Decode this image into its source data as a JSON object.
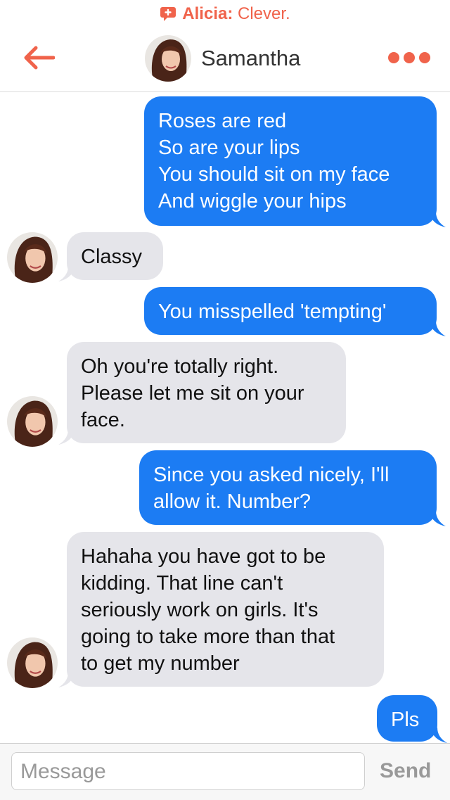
{
  "notification": {
    "sender": "Alicia",
    "separator": ":",
    "message": "Clever."
  },
  "header": {
    "contact_name": "Samantha",
    "back_icon": "arrow-left-icon",
    "more_icon": "ellipsis-icon"
  },
  "colors": {
    "accent": "#f0634b",
    "outgoing": "#1c7cf3",
    "incoming": "#e5e5ea"
  },
  "messages": [
    {
      "direction": "out",
      "text": "Roses are red\nSo are your lips\nYou should sit on my face\nAnd wiggle your hips"
    },
    {
      "direction": "in",
      "text": "Classy"
    },
    {
      "direction": "out",
      "text": "You misspelled 'tempting'"
    },
    {
      "direction": "in",
      "text": "Oh you're totally right.\nPlease let me sit on your\nface."
    },
    {
      "direction": "out",
      "text": "Since you asked nicely, I'll\nallow it. Number?"
    },
    {
      "direction": "in",
      "text": "Hahaha you have got to be\nkidding. That line can't\nseriously work on girls. It's\ngoing to take more than that\nto get my number"
    },
    {
      "direction": "out",
      "text": "Pls"
    }
  ],
  "composer": {
    "placeholder": "Message",
    "send_label": "Send"
  }
}
